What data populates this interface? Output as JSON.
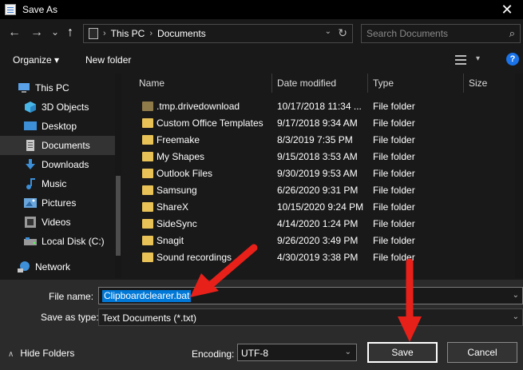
{
  "window": {
    "title": "Save As",
    "close_glyph": "✕"
  },
  "nav": {
    "back_icon": "←",
    "forward_icon": "→",
    "recent_icon": "⌄",
    "up_icon": "↑",
    "breadcrumb": [
      "This PC",
      "Documents"
    ],
    "crumb_sep": "›",
    "search_placeholder": "Search Documents"
  },
  "toolbar": {
    "organize": "Organize ▾",
    "new_folder": "New folder",
    "help": "?"
  },
  "sidebar": {
    "items": [
      {
        "label": "This PC",
        "icon": "pc-icon",
        "color": "#5aa0e6"
      },
      {
        "label": "3D Objects",
        "icon": "cube-icon",
        "color": "#49b6e8"
      },
      {
        "label": "Desktop",
        "icon": "desktop-icon",
        "color": "#3d8fd8"
      },
      {
        "label": "Documents",
        "icon": "documents-icon",
        "color": "#c8c8c8"
      },
      {
        "label": "Downloads",
        "icon": "download-icon",
        "color": "#3d8fd8"
      },
      {
        "label": "Music",
        "icon": "music-icon",
        "color": "#3d8fd8"
      },
      {
        "label": "Pictures",
        "icon": "pictures-icon",
        "color": "#6aa6dc"
      },
      {
        "label": "Videos",
        "icon": "videos-icon",
        "color": "#9a9a9a"
      },
      {
        "label": "Local Disk (C:)",
        "icon": "disk-icon",
        "color": "#9a9a9a"
      },
      {
        "label": "Network",
        "icon": "network-icon",
        "color": "#3d8fd8"
      }
    ],
    "selected_index": 3
  },
  "columns": {
    "name": "Name",
    "date": "Date modified",
    "type": "Type",
    "size": "Size",
    "sort_arrow": "^"
  },
  "files": [
    {
      "name": ".tmp.drivedownload",
      "date": "10/17/2018 11:34 ...",
      "type": "File folder",
      "dim": true
    },
    {
      "name": "Custom Office Templates",
      "date": "9/17/2018 9:34 AM",
      "type": "File folder"
    },
    {
      "name": "Freemake",
      "date": "8/3/2019 7:35 PM",
      "type": "File folder"
    },
    {
      "name": "My Shapes",
      "date": "9/15/2018 3:53 AM",
      "type": "File folder"
    },
    {
      "name": "Outlook Files",
      "date": "9/30/2019 9:53 AM",
      "type": "File folder"
    },
    {
      "name": "Samsung",
      "date": "6/26/2020 9:31 PM",
      "type": "File folder"
    },
    {
      "name": "ShareX",
      "date": "10/15/2020 9:24 PM",
      "type": "File folder"
    },
    {
      "name": "SideSync",
      "date": "4/14/2020 1:24 PM",
      "type": "File folder"
    },
    {
      "name": "Snagit",
      "date": "9/26/2020 3:49 PM",
      "type": "File folder"
    },
    {
      "name": "Sound recordings",
      "date": "4/30/2019 3:38 PM",
      "type": "File folder"
    }
  ],
  "form": {
    "file_name_label": "File name:",
    "file_name_value": "Clipboardclearer.bat",
    "save_type_label": "Save as type:",
    "save_type_value": "Text Documents (*.txt)",
    "hide_folders": "Hide Folders",
    "encoding_label": "Encoding:",
    "encoding_value": "UTF-8",
    "save": "Save",
    "cancel": "Cancel"
  },
  "colors": {
    "accent": "#0078d7",
    "arrow": "#e8201a",
    "folder": "#e8c257"
  }
}
